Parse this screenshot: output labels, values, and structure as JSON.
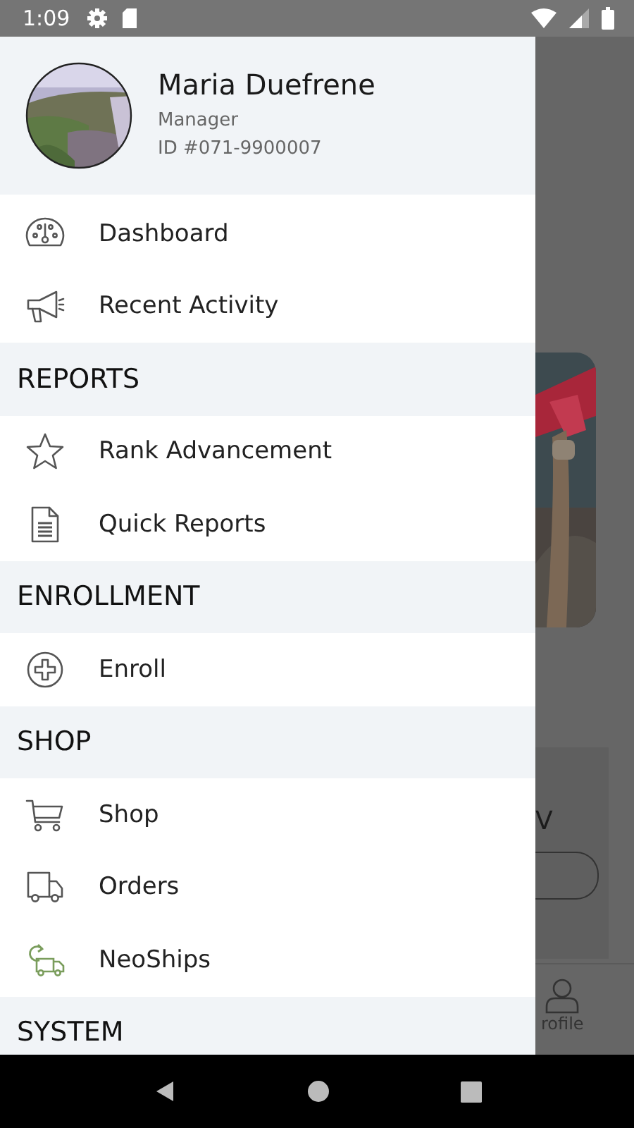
{
  "status_bar": {
    "time": "1:09"
  },
  "profile": {
    "name": "Maria Duefrene",
    "role": "Manager",
    "id": "ID #071-9900007"
  },
  "menu": [
    {
      "kind": "item",
      "label": "Dashboard"
    },
    {
      "kind": "item",
      "label": "Recent Activity"
    },
    {
      "kind": "section",
      "label": "REPORTS"
    },
    {
      "kind": "item",
      "label": "Rank Advancement"
    },
    {
      "kind": "item",
      "label": "Quick Reports"
    },
    {
      "kind": "section",
      "label": "ENROLLMENT"
    },
    {
      "kind": "item",
      "label": "Enroll"
    },
    {
      "kind": "section",
      "label": "SHOP"
    },
    {
      "kind": "item",
      "label": "Shop"
    },
    {
      "kind": "item",
      "label": "Orders"
    },
    {
      "kind": "item",
      "label": "NeoShips"
    },
    {
      "kind": "section",
      "label": "SYSTEM"
    }
  ],
  "background": {
    "card_text": "V",
    "nav_label": "rofile"
  }
}
